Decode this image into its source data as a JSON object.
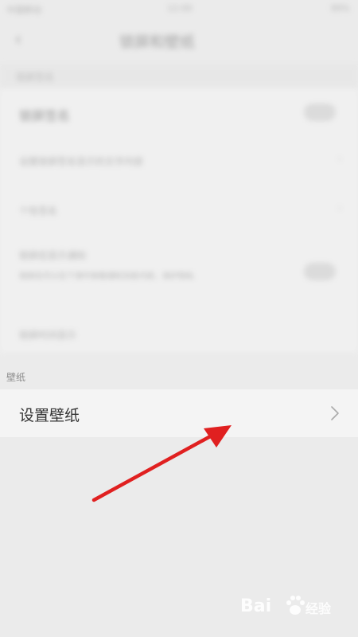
{
  "status_bar": {
    "carrier": "中国移动",
    "time": "12:00",
    "battery": "99%"
  },
  "header": {
    "title": "锁屏和壁纸",
    "back_icon": "back-arrow-icon"
  },
  "sections": [
    {
      "heading": "锁屏签名",
      "rows": [
        {
          "label": "锁屏签名",
          "control": "toggle"
        },
        {
          "label": "设置锁屏签名显示的文字内容",
          "control": "chevron"
        },
        {
          "label": "个性签名",
          "control": "chevron"
        },
        {
          "label": "锁屏后显示通知",
          "sublabel": "锁屏后可以在下滑中查看通知消息内容，保护隐私",
          "control": "toggle"
        },
        {
          "label": "锁屏时间显示",
          "control": "none"
        }
      ]
    },
    {
      "heading": "壁纸",
      "rows": [
        {
          "label": "设置壁纸",
          "control": "chevron"
        }
      ]
    }
  ],
  "annotation": {
    "type": "red-arrow",
    "color": "#e02020"
  },
  "watermark": {
    "text_left": "Bai",
    "text_right": "经验",
    "icon": "paw-icon"
  }
}
